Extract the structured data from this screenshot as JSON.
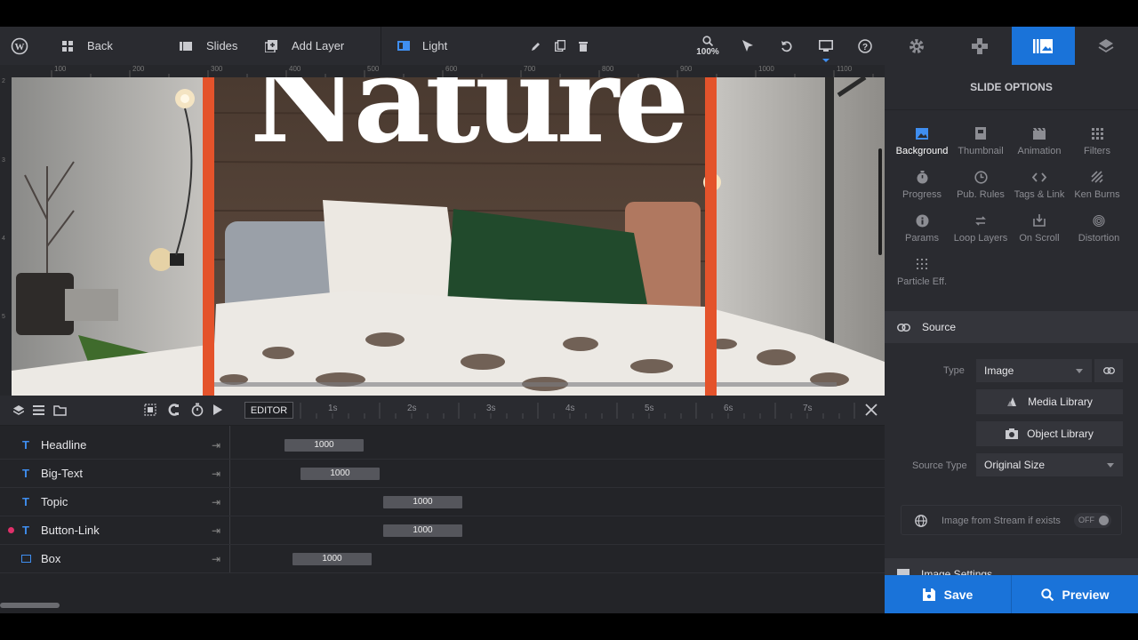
{
  "toolbar": {
    "back_label": "Back",
    "slides_label": "Slides",
    "add_layer_label": "Add Layer",
    "light_label": "Light",
    "zoom_label": "100%"
  },
  "rulers": {
    "horizontal_ticks": [
      "100",
      "200",
      "300",
      "400",
      "500",
      "600",
      "700",
      "800",
      "900",
      "1000",
      "1100"
    ],
    "vertical_ticks": [
      "2",
      "3",
      "4",
      "5"
    ]
  },
  "canvas": {
    "headline_text": "Nature",
    "guide_color": "#e4532b"
  },
  "timeline": {
    "editor_label": "EDITOR",
    "ticks": [
      "1s",
      "2s",
      "3s",
      "4s",
      "5s",
      "6s",
      "7s"
    ],
    "layers": [
      {
        "name": "Headline",
        "icon": "T",
        "duration": "1000"
      },
      {
        "name": "Big-Text",
        "icon": "T",
        "duration": "1000"
      },
      {
        "name": "Topic",
        "icon": "T",
        "duration": "1000"
      },
      {
        "name": "Button-Link",
        "icon": "T",
        "duration": "1000"
      },
      {
        "name": "Box",
        "icon": "box",
        "duration": "1000"
      }
    ]
  },
  "panel": {
    "title": "SLIDE OPTIONS",
    "options": [
      {
        "label": "Background",
        "icon": "image-icon",
        "active": true
      },
      {
        "label": "Thumbnail",
        "icon": "thumbnail-icon"
      },
      {
        "label": "Animation",
        "icon": "film-icon"
      },
      {
        "label": "Filters",
        "icon": "filters-icon"
      },
      {
        "label": "Progress",
        "icon": "stopwatch-icon"
      },
      {
        "label": "Pub. Rules",
        "icon": "clock-icon"
      },
      {
        "label": "Tags & Link",
        "icon": "code-icon"
      },
      {
        "label": "Ken Burns",
        "icon": "kenburns-icon"
      },
      {
        "label": "Params",
        "icon": "info-icon"
      },
      {
        "label": "Loop Layers",
        "icon": "loop-icon"
      },
      {
        "label": "On Scroll",
        "icon": "scroll-icon"
      },
      {
        "label": "Distortion",
        "icon": "fingerprint-icon"
      },
      {
        "label": "Particle Eff.",
        "icon": "particles-icon"
      }
    ],
    "source_section": "Source",
    "type_label": "Type",
    "type_value": "Image",
    "media_library": "Media Library",
    "object_library": "Object Library",
    "source_type_label": "Source Type",
    "source_type_value": "Original Size",
    "stream_label": "Image from Stream if exists",
    "stream_toggle": "OFF",
    "image_settings": "Image Settings"
  },
  "footer": {
    "save_label": "Save",
    "preview_label": "Preview"
  },
  "colors": {
    "accent": "#1a73d9",
    "orange_guide": "#e4532b"
  }
}
